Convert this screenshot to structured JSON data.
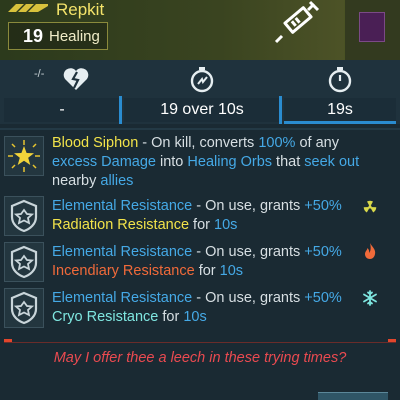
{
  "header": {
    "item_name": "Repkit",
    "heal_value": "19",
    "heal_label": "Healing",
    "rarity_icon": "double-chevron-icon",
    "item_icon": "syringe-icon"
  },
  "stats": {
    "cooldown_tag": "-/-",
    "values": [
      "-",
      "19 over 10s",
      "19s"
    ],
    "icons": [
      "heart-broken-icon",
      "timer-icon",
      "stopwatch-icon"
    ]
  },
  "perks": [
    {
      "icon": "star-badge-icon",
      "parts": {
        "name": "Blood Siphon",
        "t1": " - On kill, converts ",
        "pct": "100%",
        "t2": " of any",
        "excess": "excess Damage",
        "t3": " into ",
        "orbs": "Healing Orbs",
        "t4": " that ",
        "seek": "seek out",
        "t5": "nearby ",
        "allies": "allies"
      }
    },
    {
      "icon": "shield-emblem-icon",
      "name": "Elemental Resistance",
      "desc": " - On use, grants ",
      "bonus": "+50%",
      "resist": "Radiation Resistance",
      "for": " for ",
      "dur": "10s",
      "element_icon": "radiation-icon"
    },
    {
      "icon": "shield-emblem-icon",
      "name": "Elemental Resistance",
      "desc": " - On use, grants ",
      "bonus": "+50%",
      "resist": "Incendiary Resistance",
      "for": " for ",
      "dur": "10s",
      "element_icon": "fire-icon"
    },
    {
      "icon": "shield-emblem-icon",
      "name": "Elemental Resistance",
      "desc": " - On use, grants ",
      "bonus": "+50%",
      "resist": "Cryo Resistance",
      "for": " for ",
      "dur": "10s",
      "element_icon": "snowflake-icon"
    }
  ],
  "flavor_text": "May I offer thee a leech in these trying times?",
  "colors": {
    "rarity_yellow": "#f2e34a",
    "highlight_blue": "#45a9e6",
    "flavor_red": "#ea4a50",
    "radiation": "#d8d84a",
    "incendiary": "#f06a3a",
    "cryo": "#7fe6e0"
  }
}
